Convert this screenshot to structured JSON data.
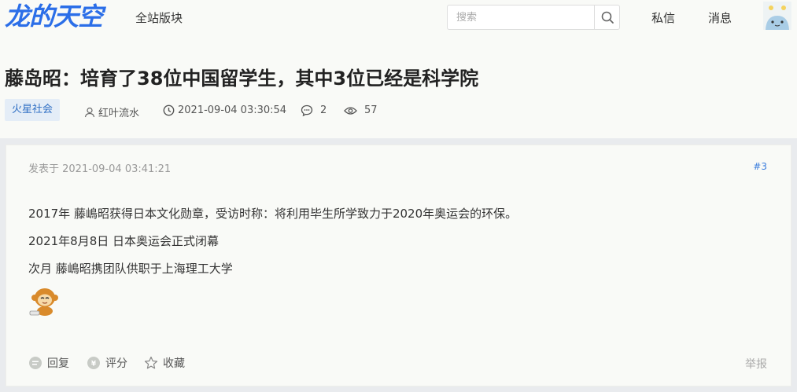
{
  "topbar": {
    "logo_text": "龙的天空",
    "nav_all": "全站版块",
    "search_placeholder": "搜索",
    "messages_label": "私信",
    "notifications_label": "消息",
    "icons": [
      "search-icon",
      "user-avatar"
    ]
  },
  "thread": {
    "title": "藤岛昭：培育了38位中国留学生，其中3位已经是科学院",
    "tag": "火星社会",
    "author": "红叶流水",
    "datetime": "2021-09-04 03:30:54",
    "replies": "2",
    "views": "57",
    "colors": {
      "tag_bg": "#e4edf7",
      "tag_text": "#2f6fc4",
      "logo": "#2b6ee8"
    }
  },
  "post": {
    "posted_at": "发表于 2021-09-04 03:41:21",
    "floor": "#3",
    "lines": [
      "2017年 藤嶋昭获得日本文化勋章，受访时称：将利用毕生所学致力于2020年奥运会的环保。",
      "2021年8月8日 日本奥运会正式闭幕",
      "次月 藤嶋昭携团队供职于上海理工大学"
    ],
    "emoji": "monkey-emoji",
    "actions": {
      "reply": "回复",
      "rate": "评分",
      "favorite": "收藏",
      "report": "举报"
    }
  }
}
